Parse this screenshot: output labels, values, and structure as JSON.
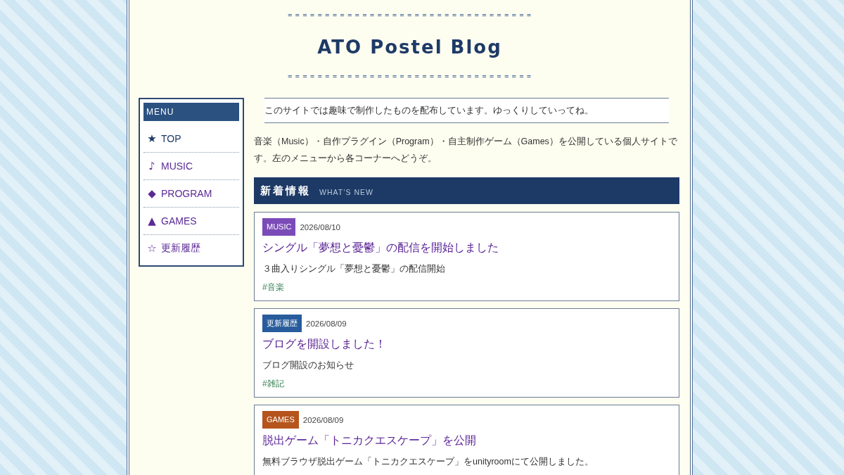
{
  "header": {
    "rule_top": "=================================",
    "title": "ATO Postel Blog",
    "rule_bottom": "================================="
  },
  "menu": {
    "heading": "MENU",
    "items": [
      {
        "mark": "★",
        "label": "TOP",
        "selected": true
      },
      {
        "mark": "♪",
        "label": "MUSIC",
        "selected": false
      },
      {
        "mark": "◆",
        "label": "PROGRAM",
        "selected": false
      },
      {
        "mark": "▲",
        "label": "GAMES",
        "selected": false
      },
      {
        "mark": "☆",
        "label": "更新履歴",
        "selected": false
      }
    ]
  },
  "intro": "このサイトでは趣味で制作したものを配布しています。ゆっくりしていってね。",
  "description": "音楽（Music）・自作プラグイン（Program）・自主制作ゲーム（Games）を公開している個人サイトです。左のメニューから各コーナーへどうぞ。",
  "news": {
    "title": "新着情報",
    "subtitle": "WHAT’S NEW",
    "posts": [
      {
        "category": "MUSIC",
        "color": "#7b4bb8",
        "date": "2026/08/10",
        "title": "シングル「夢想と憂鬱」の配信を開始しました",
        "summary": "３曲入りシングル「夢想と憂鬱」の配信開始",
        "tag": "#音楽"
      },
      {
        "category": "更新履歴",
        "color": "#285c9c",
        "date": "2026/08/09",
        "title": "ブログを開設しました！",
        "summary": "ブログ開設のお知らせ",
        "tag": "#雑記"
      },
      {
        "category": "GAMES",
        "color": "#b5541c",
        "date": "2026/08/09",
        "title": "脱出ゲーム「トニカクエスケープ」を公開",
        "summary": "無料ブラウザ脱出ゲーム「トニカクエスケープ」をunityroomにて公開しました。"
      }
    ]
  }
}
